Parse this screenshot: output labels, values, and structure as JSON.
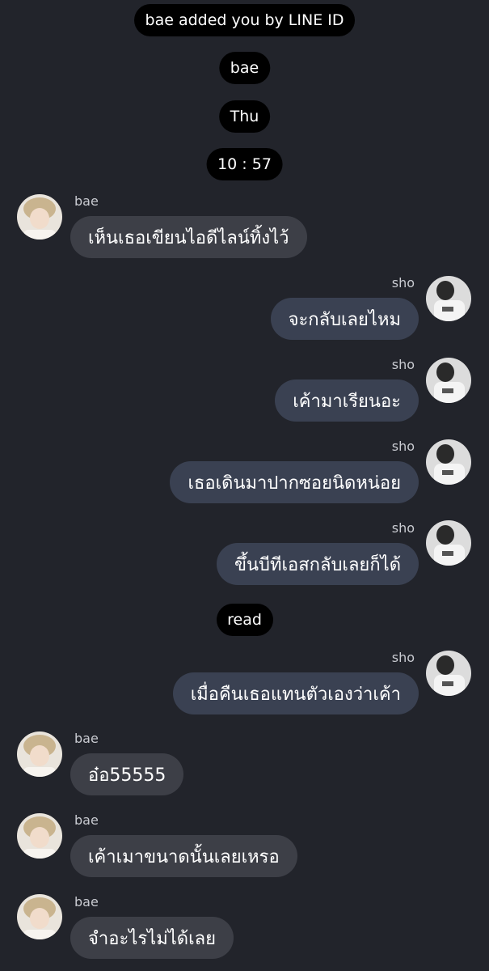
{
  "system": {
    "added_notice": "bae added you by LINE ID",
    "name_label": "bae",
    "day_label": "Thu",
    "time_label": "10 : 57",
    "read_label": "read"
  },
  "messages": [
    {
      "sender": "bae",
      "text": "เห็นเธอเขียนไอดีไลน์ทิ้งไว้"
    },
    {
      "sender": "sho",
      "text": "จะกลับเลยไหม"
    },
    {
      "sender": "sho",
      "text": "เค้ามาเรียนอะ"
    },
    {
      "sender": "sho",
      "text": "เธอเดินมาปากซอยนิดหน่อย"
    },
    {
      "sender": "sho",
      "text": "ขึ้นบีทีเอสกลับเลยก็ได้"
    },
    {
      "sender": "sho",
      "text": "เมื่อคืนเธอแทนตัวเองว่าเค้า"
    },
    {
      "sender": "bae",
      "text": "อ๋อ55555"
    },
    {
      "sender": "bae",
      "text": "เค้าเมาขนาดนั้นเลยเหรอ"
    },
    {
      "sender": "bae",
      "text": "จำอะไรไม่ได้เลย"
    }
  ]
}
